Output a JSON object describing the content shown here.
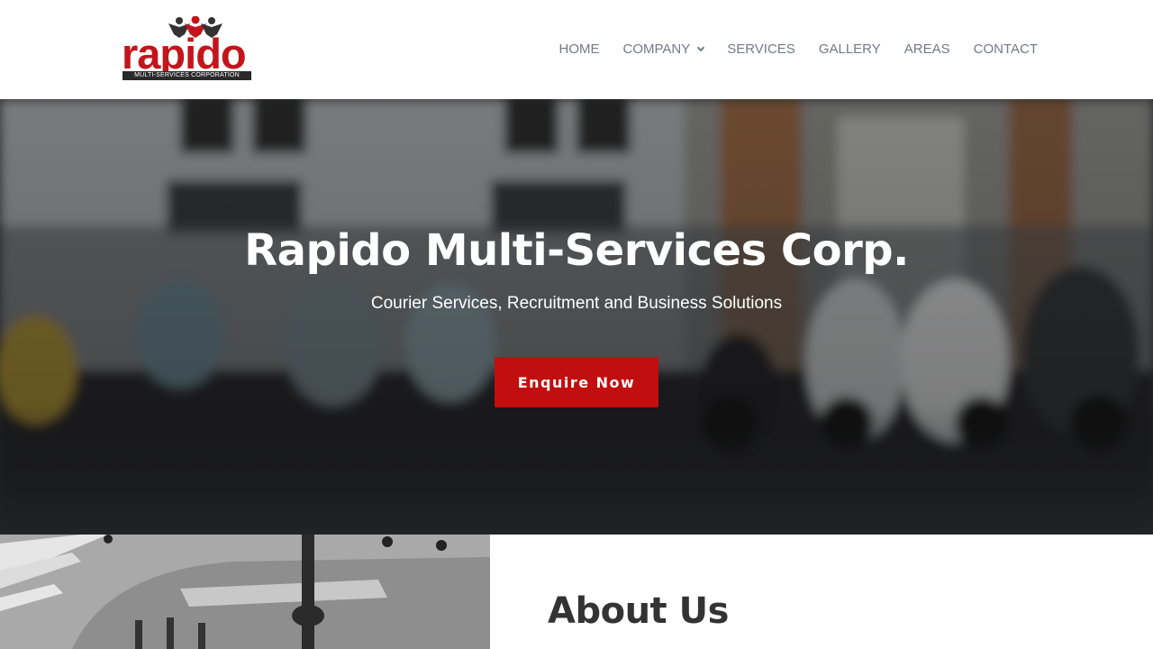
{
  "brand": {
    "logo_word": "rapido",
    "logo_tagline": "MULTI-SERVICES CORPORATION",
    "brand_red": "#c4151c"
  },
  "nav": {
    "items": [
      {
        "label": "HOME"
      },
      {
        "label": "COMPANY",
        "has_dropdown": true
      },
      {
        "label": "SERVICES"
      },
      {
        "label": "GALLERY"
      },
      {
        "label": "AREAS"
      },
      {
        "label": "CONTACT"
      }
    ],
    "text_color": "#727a86"
  },
  "hero": {
    "title": "Rapido Multi-Services Corp.",
    "subtitle": "Courier Services, Recruitment and Business Solutions",
    "cta_label": "Enquire Now",
    "cta_color": "#c20e0e",
    "background": "blurred street with parked scooters"
  },
  "about": {
    "title": "About Us",
    "image": "grayscale aerial street crossing"
  }
}
